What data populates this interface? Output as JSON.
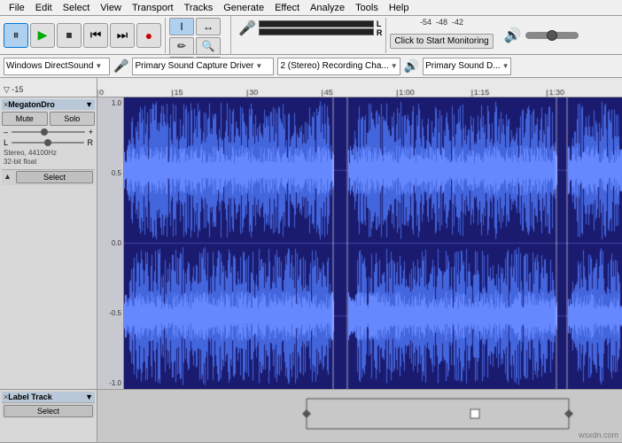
{
  "menu": {
    "items": [
      "File",
      "Edit",
      "Select",
      "View",
      "Transport",
      "Tracks",
      "Generate",
      "Effect",
      "Analyze",
      "Tools",
      "Help"
    ]
  },
  "toolbar": {
    "pause_label": "⏸",
    "play_label": "▶",
    "stop_label": "⏹",
    "skip_back_label": "⏮",
    "skip_fwd_label": "⏭",
    "record_label": "●",
    "tools": [
      "I",
      "↔",
      "✏",
      "↕",
      "✱"
    ],
    "monitor_label": "Click to Start Monitoring",
    "vu_scale": "-54  -48  -42"
  },
  "device_toolbar": {
    "host": "Windows DirectSound",
    "mic_label": "🎤",
    "input_device": "Primary Sound Capture Driver",
    "channels": "2 (Stereo) Recording Cha...",
    "speaker_label": "🔊",
    "output_device": "Primary Sound D..."
  },
  "timeline": {
    "markers": [
      "-15",
      "0",
      "15",
      "30",
      "45",
      "1:00",
      "1:15",
      "1:30"
    ]
  },
  "audio_track": {
    "name": "MegatonDro",
    "mute_label": "Mute",
    "solo_label": "Solo",
    "gain_minus": "–",
    "gain_plus": "+",
    "pan_left": "L",
    "pan_right": "R",
    "info_line1": "Stereo, 44100Hz",
    "info_line2": "32-bit float",
    "select_label": "Select",
    "collapse_icon": "▲",
    "db_labels": [
      "1.0",
      "0.5",
      "0.0",
      "-0.5",
      "-1.0",
      "1.0",
      "0.5",
      "0.0",
      "-0.5",
      "-1.0"
    ]
  },
  "label_track": {
    "name": "Label Track",
    "select_label": "Select",
    "close": "×",
    "dropdown": "▼"
  },
  "waveform": {
    "color": "#3333cc",
    "background": "#1a1a6e"
  }
}
